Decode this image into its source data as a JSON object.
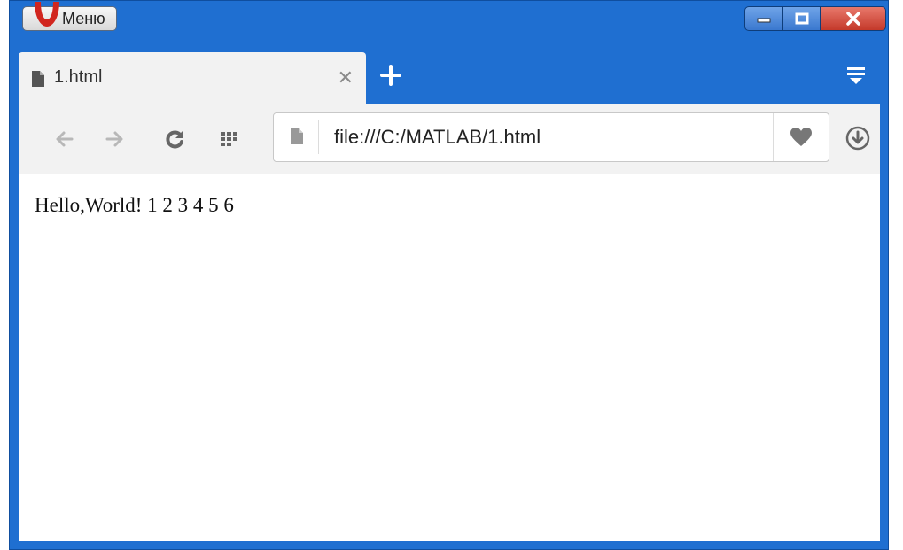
{
  "titlebar": {
    "menu_label": "Меню",
    "controls": [
      "minimize-icon",
      "maximize-icon",
      "close-icon"
    ]
  },
  "tab": {
    "title": "1.html",
    "icons": [
      "page-icon",
      "close-icon",
      "plus-icon",
      "tab-menu-icon"
    ]
  },
  "toolbar": {
    "icons": [
      "back-arrow-icon",
      "forward-arrow-icon",
      "reload-icon",
      "speed-dial-icon",
      "heart-icon",
      "download-icon"
    ]
  },
  "address_bar": {
    "url": "file:///C:/MATLAB/1.html"
  },
  "page": {
    "text": "Hello,World! 1 2 3 4 5 6"
  },
  "colors": {
    "frame": "#1f6fd1",
    "close_button": "#c4392a",
    "toolbar_bg": "#f2f2f2"
  }
}
